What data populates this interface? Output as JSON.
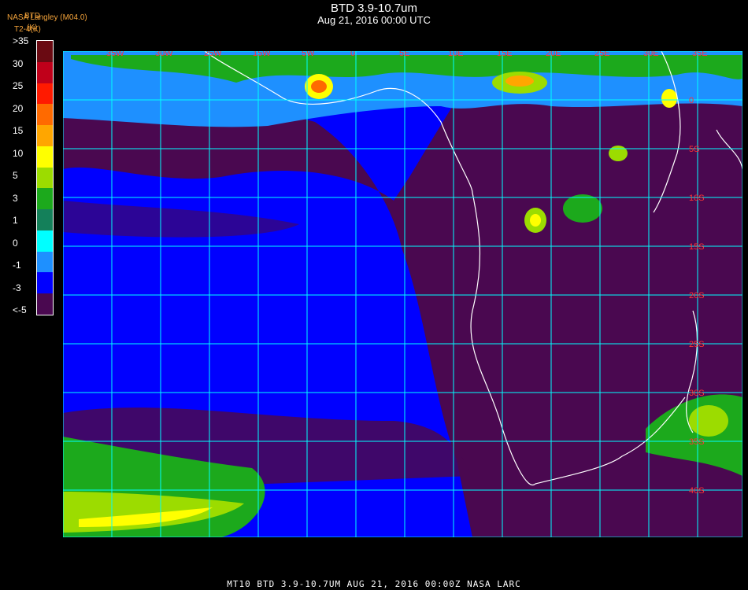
{
  "header": {
    "title": "BTD 3.9-10.7um",
    "subtitle": "Aug 21, 2016 00:00 UTC",
    "credit_line1": "NASA Langley (M04.0)",
    "credit_line2": "T2-4(K)",
    "colorbar_title_line1": "BTD",
    "colorbar_title_line2": "(K)"
  },
  "colorbar": {
    "labels": [
      ">35",
      "30",
      "25",
      "20",
      "15",
      "10",
      "5",
      "3",
      "1",
      "0",
      "-1",
      "-3",
      "<-5"
    ],
    "colors": [
      "#6a0a12",
      "#c0001a",
      "#ff1a00",
      "#ff6a00",
      "#ffa600",
      "#ffff00",
      "#9cdc00",
      "#1ca91c",
      "#14805a",
      "#00ffff",
      "#1e90ff",
      "#0000ff",
      "#4a0850"
    ]
  },
  "map": {
    "longitude_labels": [
      "35W",
      "30W",
      "25W",
      "15W",
      "5W",
      "0",
      "5E",
      "10E",
      "15E",
      "20E",
      "25E",
      "30E",
      "35E"
    ],
    "latitude_labels": [
      "0",
      "5S",
      "10S",
      "15S",
      "20S",
      "25S",
      "30S",
      "35S",
      "40S"
    ],
    "colors": {
      "ocean": "#0000ff",
      "clear": "#4a0850",
      "cloud_light": "#1e90ff",
      "cloud_mid": "#9cdc00",
      "cloud_high": "#ffff00",
      "grid": "#00ffff",
      "coast": "#ffffff",
      "label": "#ff3333"
    }
  },
  "footer": {
    "text": "MT10  BTD 3.9-10.7UM   AUG 21, 2016 00:00Z   NASA LARC"
  }
}
